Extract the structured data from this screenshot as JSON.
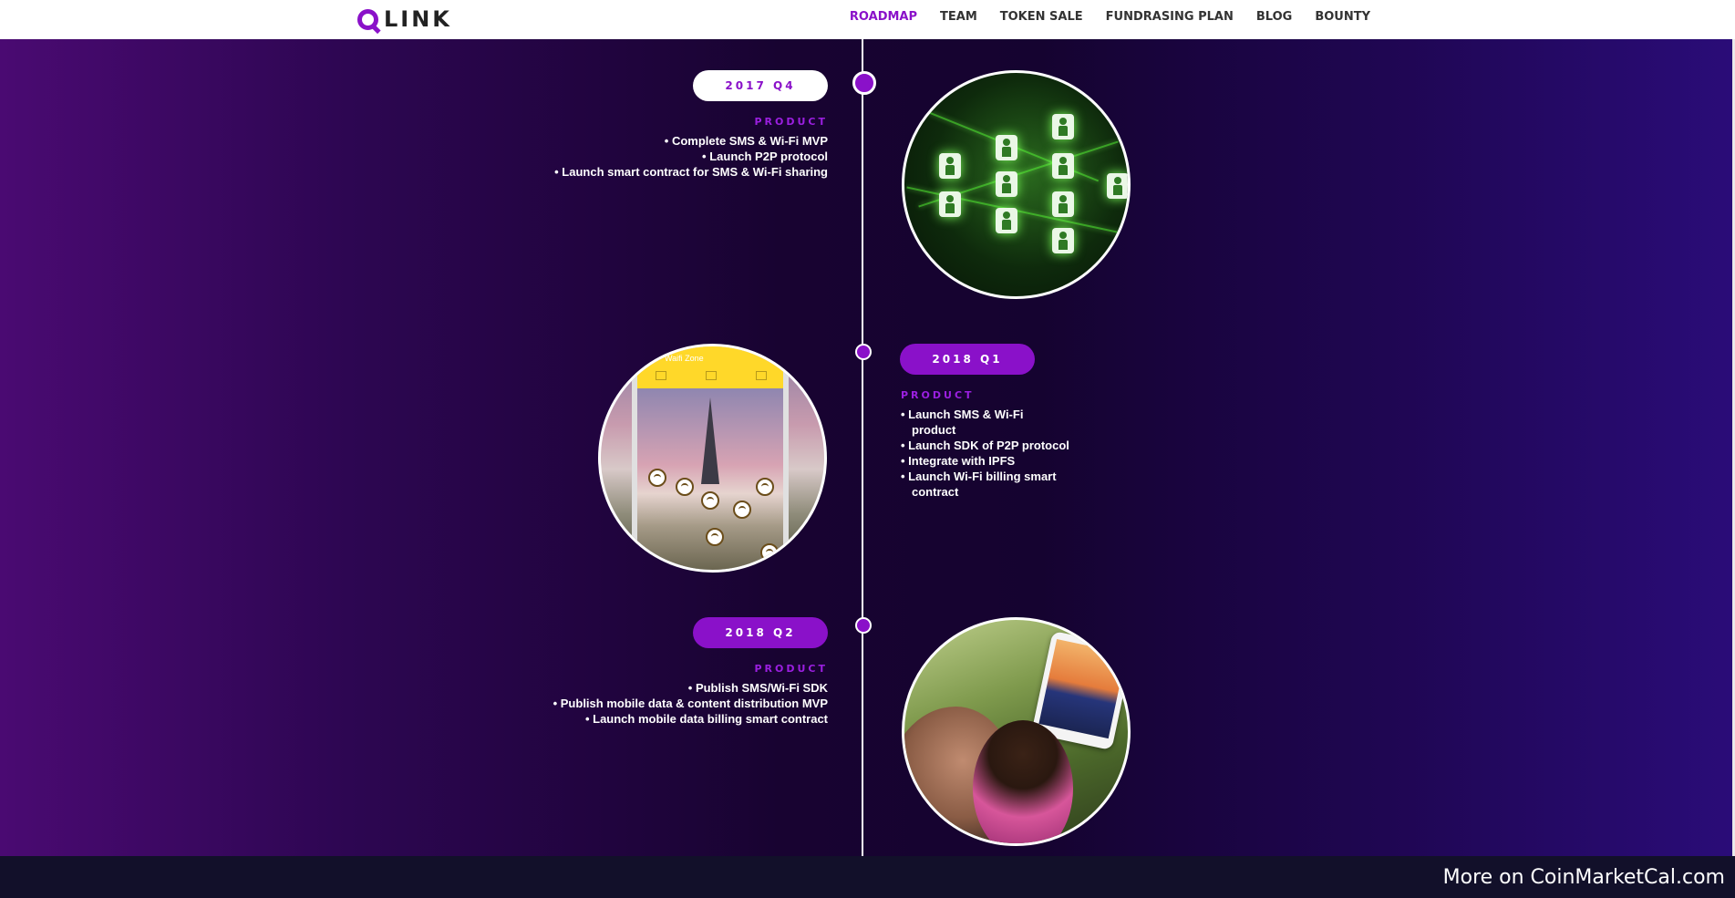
{
  "nav": {
    "logo_text": "LINK",
    "items": [
      "ROADMAP",
      "TEAM",
      "TOKEN SALE",
      "FUNDRASING PLAN",
      "BLOG",
      "BOUNTY"
    ],
    "active": "ROADMAP"
  },
  "timeline": [
    {
      "period": "2017 Q4",
      "section": "PRODUCT",
      "items": [
        "Complete SMS & Wi-Fi MVP",
        "Launch P2P protocol",
        "Launch smart contract for SMS & Wi-Fi sharing"
      ]
    },
    {
      "period": "2018 Q1",
      "section": "PRODUCT",
      "items": [
        "Launch SMS & Wi-Fi product",
        "Launch SDK of P2P protocol",
        "Integrate with IPFS",
        "Launch Wi-Fi billing smart contract"
      ],
      "phone_title": "Waifi Zone"
    },
    {
      "period": "2018 Q2",
      "section": "PRODUCT",
      "items": [
        "Publish SMS/Wi-Fi SDK",
        "Publish mobile data & content distribution MVP",
        "Launch mobile data billing smart contract"
      ]
    }
  ],
  "footer": {
    "text": "More on CoinMarketCal.com"
  },
  "colors": {
    "accent": "#8a11c9",
    "nav_bg": "#ffffff",
    "footer_bg": "#12102a"
  }
}
